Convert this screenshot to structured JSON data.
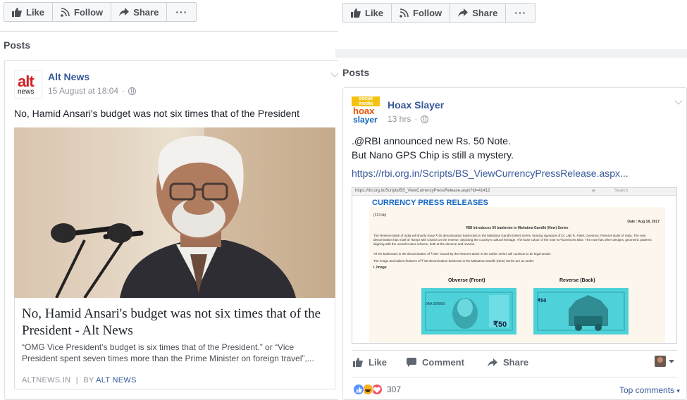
{
  "left": {
    "actions": {
      "like": "Like",
      "follow": "Follow",
      "share": "Share",
      "more": "···"
    },
    "section": "Posts",
    "post": {
      "page_name": "Alt News",
      "logo_text_1": "alt",
      "logo_text_2": "news",
      "timestamp": "15 August at 18:04",
      "text": "No, Hamid Ansari's budget was not six times that of the President",
      "link_title": "No, Hamid Ansari's budget was not six times that of the President - Alt News",
      "link_desc": "“OMG Vice President’s budget is six times that of the President.” or “Vice President spent seven times more than the Prime Minister on foreign travel”,...",
      "link_domain": "ALTNEWS.IN",
      "link_sep": "|",
      "link_by": "BY",
      "link_author": "ALT NEWS"
    }
  },
  "right": {
    "actions": {
      "like": "Like",
      "follow": "Follow",
      "share": "Share",
      "more": "···"
    },
    "section": "Posts",
    "post": {
      "page_name": "Hoax Slayer",
      "logo_line1": "social",
      "logo_line2": "media",
      "logo_line3": "hoax",
      "logo_line4": "slayer",
      "timestamp": "13 hrs",
      "text_line1": ".@RBI announced new Rs. 50 Note.",
      "text_line2": "But Nano GPS Chip is still a mystery.",
      "link": "https://rbi.org.in/Scripts/BS_ViewCurrencyPressRelease.aspx...",
      "screenshot": {
        "url": "https://rbi.org.in/Scripts/BS_ViewCurrencyPressRelease.aspx?id=41412",
        "search": "Search",
        "heading": "CURRENCY PRESS RELEASES",
        "pdf": "(313 kb)",
        "date": "Date : Aug 18, 2017",
        "release_title": "RBI Introduces 50 banknote in Mahatma Gandhi (New) Series",
        "para1": "The Reserve Bank of India will shortly issue ₹ 50 denomination banknotes in the Mahatma Gandhi (New) Series, bearing signature of Dr. Urjit R. Patel, Governor, Reserve Bank of India. The new denomination has motif of Hampi with Chariot on the reverse, depicting the country's cultural heritage. The base colour of the note is Fluorescent Blue. The note has other designs, geometric patterns aligning with the overall colour scheme, both at the obverse and reverse.",
        "para2": "All the banknotes in the denomination of ₹ 50/- issued by the Reserve Bank in the earlier series will continue to be legal tender.",
        "para3": "The image and salient features of ₹ 50 denomination banknote in the Mahatma Gandhi (New) Series are as under:",
        "image_label": "i. Image",
        "obverse": "Obverse (Front)",
        "reverse": "Reverse (Back)",
        "note_value": "₹50",
        "serial": "0AA 000000"
      },
      "foot": {
        "like": "Like",
        "comment": "Comment",
        "share": "Share"
      },
      "reactions_count": "307",
      "top_comments": "Top comments"
    }
  },
  "colors": {
    "link": "#365899",
    "text": "#1d2129",
    "meta": "#90949c",
    "rbi_blue": "#1565c0",
    "note_teal": "#4fd1d9"
  }
}
